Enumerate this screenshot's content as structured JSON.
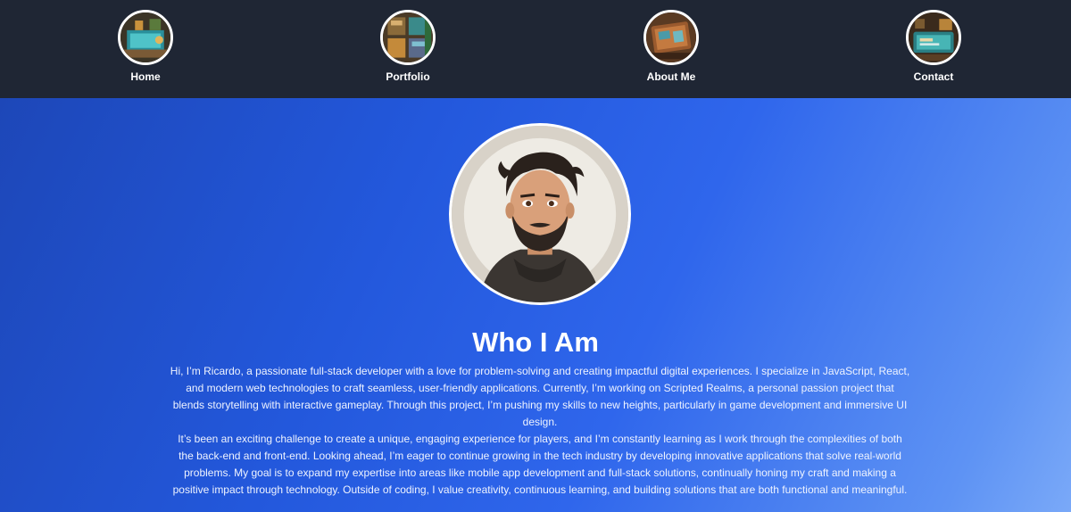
{
  "nav": {
    "items": [
      {
        "label": "Home",
        "icon": "home-thumbnail-icon"
      },
      {
        "label": "Portfolio",
        "icon": "portfolio-thumbnail-icon"
      },
      {
        "label": "About Me",
        "icon": "about-thumbnail-icon"
      },
      {
        "label": "Contact",
        "icon": "contact-thumbnail-icon"
      }
    ]
  },
  "about": {
    "title": "Who I Am",
    "paragraphs": [
      "Hi, I’m Ricardo, a passionate full-stack developer with a love for problem-solving and creating impactful digital experiences. I specialize in JavaScript, React, and modern web technologies to craft seamless, user-friendly applications. Currently, I’m working on Scripted Realms, a personal passion project that blends storytelling with interactive gameplay. Through this project, I’m pushing my skills to new heights, particularly in game development and immersive UI design.",
      "It’s been an exciting challenge to create a unique, engaging experience for players, and I’m constantly learning as I work through the complexities of both the back-end and front-end. Looking ahead, I’m eager to continue growing in the tech industry by developing innovative applications that solve real-world problems. My goal is to expand my expertise into areas like mobile app development and full-stack solutions, continually honing my craft and making a positive impact through technology. Outside of coding, I value creativity, continuous learning, and building solutions that are both functional and meaningful."
    ]
  },
  "colors": {
    "navbar_bg": "#1f2634",
    "hero_gradient_start": "#1d47b8",
    "hero_gradient_end": "#7aa9f8",
    "text": "#ffffff"
  }
}
